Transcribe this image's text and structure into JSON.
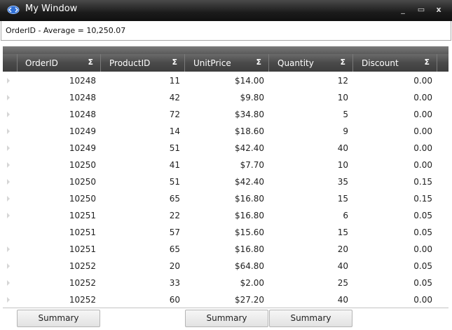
{
  "window": {
    "title": "My Window",
    "minimize": "_",
    "maximize": "▭",
    "close": "x"
  },
  "summary": {
    "text": "OrderID - Average = 10,250.07"
  },
  "columns": [
    {
      "label": "OrderID",
      "sigma": "Σ"
    },
    {
      "label": "ProductID",
      "sigma": "Σ"
    },
    {
      "label": "UnitPrice",
      "sigma": "Σ"
    },
    {
      "label": "Quantity",
      "sigma": "Σ"
    },
    {
      "label": "Discount",
      "sigma": "Σ"
    }
  ],
  "rows": [
    [
      "10248",
      "11",
      "$14.00",
      "12",
      "0.00"
    ],
    [
      "10248",
      "42",
      "$9.80",
      "10",
      "0.00"
    ],
    [
      "10248",
      "72",
      "$34.80",
      "5",
      "0.00"
    ],
    [
      "10249",
      "14",
      "$18.60",
      "9",
      "0.00"
    ],
    [
      "10249",
      "51",
      "$42.40",
      "40",
      "0.00"
    ],
    [
      "10250",
      "41",
      "$7.70",
      "10",
      "0.00"
    ],
    [
      "10250",
      "51",
      "$42.40",
      "35",
      "0.15"
    ],
    [
      "10250",
      "65",
      "$16.80",
      "15",
      "0.15"
    ],
    [
      "10251",
      "22",
      "$16.80",
      "6",
      "0.05"
    ],
    [
      "10251",
      "57",
      "$15.60",
      "15",
      "0.05"
    ],
    [
      "10251",
      "65",
      "$16.80",
      "20",
      "0.00"
    ],
    [
      "10252",
      "20",
      "$64.80",
      "40",
      "0.05"
    ],
    [
      "10252",
      "33",
      "$2.00",
      "25",
      "0.05"
    ],
    [
      "10252",
      "60",
      "$27.20",
      "40",
      "0.00"
    ]
  ],
  "row_indicator_shown": [
    true,
    true,
    true,
    true,
    true,
    true,
    true,
    true,
    true,
    false,
    true,
    true,
    true,
    true
  ],
  "footer": {
    "buttons": [
      {
        "label": "Summary",
        "column": "OrderID"
      },
      {
        "label": "Summary",
        "column": "UnitPrice"
      },
      {
        "label": "Summary",
        "column": "Quantity"
      }
    ]
  },
  "colors": {
    "title_bar": "#1b1b1b",
    "header": "#4a4a4a",
    "background": "#ffffff"
  }
}
